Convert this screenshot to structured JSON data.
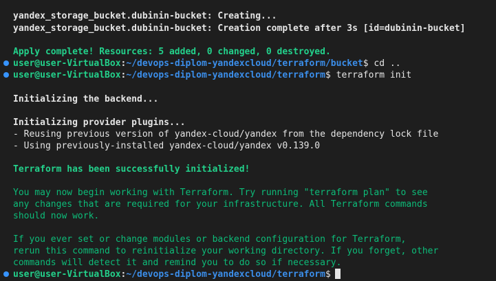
{
  "terminal": {
    "lines": [
      {
        "text": "yandex_storage_bucket.dubinin-bucket: Creating..."
      },
      {
        "text": "yandex_storage_bucket.dubinin-bucket: Creation complete after 3s [id=dubinin-bucket]"
      },
      {
        "text": ""
      },
      {
        "text": "Apply complete! Resources: 5 added, 0 changed, 0 destroyed."
      },
      {
        "text": "Initializing the backend..."
      },
      {
        "text": "Initializing provider plugins..."
      },
      {
        "text": "- Reusing previous version of yandex-cloud/yandex from the dependency lock file"
      },
      {
        "text": "- Using previously-installed yandex-cloud/yandex v0.139.0"
      },
      {
        "text": "Terraform has been successfully initialized!"
      },
      {
        "text": "You may now begin working with Terraform. Try running \"terraform plan\" to see"
      },
      {
        "text": "any changes that are required for your infrastructure. All Terraform commands"
      },
      {
        "text": "should now work."
      },
      {
        "text": "If you ever set or change modules or backend configuration for Terraform,"
      },
      {
        "text": "rerun this command to reinitialize your working directory. If you forget, other"
      },
      {
        "text": "commands will detect it and remind you to do so if necessary."
      }
    ],
    "prompts": [
      {
        "user": "user@user-VirtualBox",
        "sep": ":",
        "path": "~/devops-diplom-yandexcloud/terraform/bucket",
        "symbol": "$",
        "command": " cd .."
      },
      {
        "user": "user@user-VirtualBox",
        "sep": ":",
        "path": "~/devops-diplom-yandexcloud/terraform",
        "symbol": "$",
        "command": " terraform init"
      },
      {
        "user": "user@user-VirtualBox",
        "sep": ":",
        "path": "~/devops-diplom-yandexcloud/terraform",
        "symbol": "$",
        "command": ""
      }
    ]
  },
  "colors": {
    "background": "#1e1e1e",
    "prompt_user": "#23d18b",
    "prompt_path": "#3b8eea",
    "success": "#23d18b",
    "info": "#0dbc79",
    "decoration_dot": "#3794ff"
  }
}
